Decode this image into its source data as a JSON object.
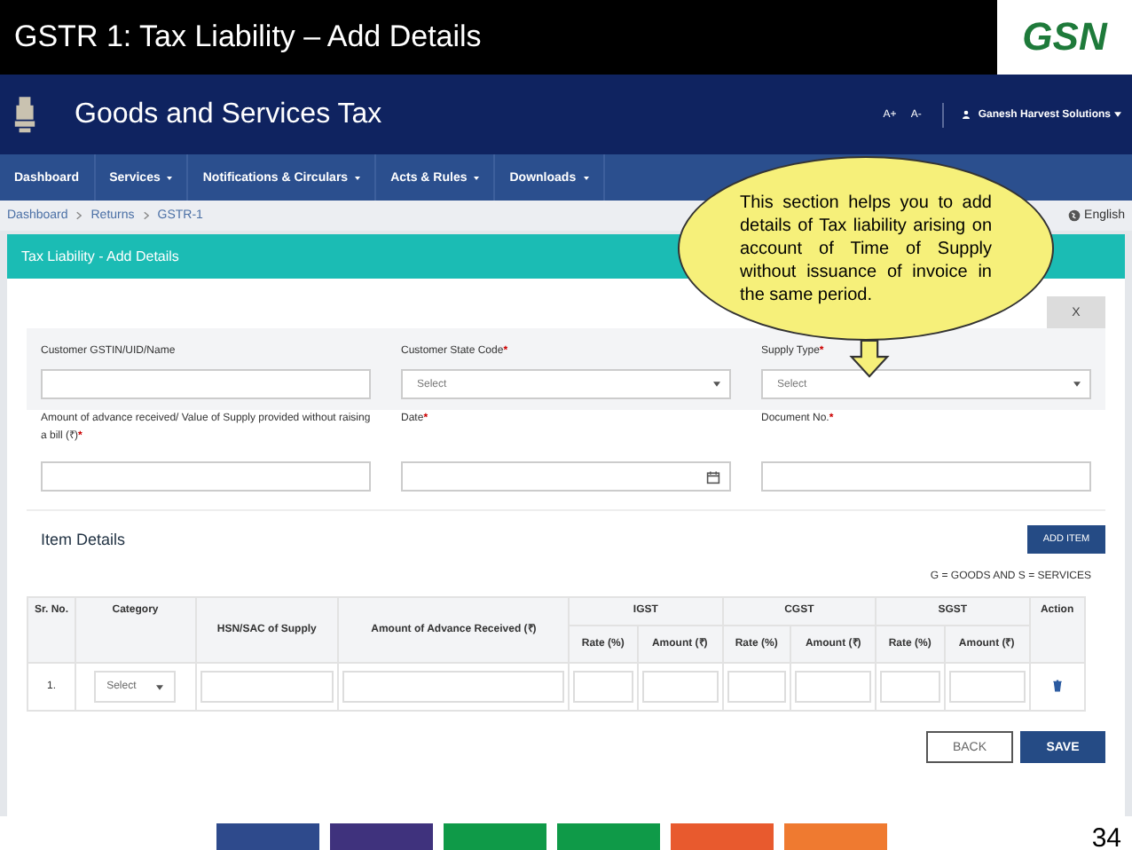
{
  "slide": {
    "title": "GSTR 1: Tax Liability – Add Details",
    "logo_text": "GSN",
    "page_number": "34"
  },
  "header": {
    "site_title": "Goods and Services Tax",
    "font_up": "A+",
    "font_down": "A-",
    "user": "Ganesh Harvest Solutions"
  },
  "nav": [
    {
      "label": "Dashboard",
      "has_menu": false
    },
    {
      "label": "Services",
      "has_menu": true
    },
    {
      "label": "Notifications & Circulars",
      "has_menu": true
    },
    {
      "label": "Acts & Rules",
      "has_menu": true
    },
    {
      "label": "Downloads",
      "has_menu": true
    }
  ],
  "breadcrumb": [
    "Dashboard",
    "Returns",
    "GSTR-1"
  ],
  "language": "English",
  "panel": {
    "title": "Tax Liability - Add Details",
    "close": "X"
  },
  "fields": [
    {
      "label": "Customer GSTIN/UID/Name",
      "kind": "text"
    },
    {
      "label": "Customer State Code",
      "required_mark": "*",
      "kind": "select",
      "placeholder": "Select"
    },
    {
      "label": "Supply Type",
      "required_mark": "*",
      "kind": "select",
      "placeholder": "Select"
    },
    {
      "label": "Amount of advance received/ Value of Supply provided without raising a bill (₹)",
      "required_mark": "*",
      "kind": "text"
    },
    {
      "label": "Date",
      "required_mark": "*",
      "kind": "date"
    },
    {
      "label": "Document No.",
      "required_mark": "*",
      "kind": "text"
    }
  ],
  "items": {
    "title": "Item Details",
    "add_button": "ADD ITEM",
    "legend": "G = GOODS AND S = SERVICES"
  },
  "table": {
    "columns": [
      "Sr. No.",
      "Category",
      "HSN/SAC of Supply",
      "Amount of Advance Received (₹)"
    ],
    "groups": [
      "IGST",
      "CGST",
      "SGST"
    ],
    "subcolumns": [
      "Rate (%)",
      "Amount (₹)",
      "Rate (%)",
      "Amount (₹)",
      "Rate (%)",
      "Amount (₹)"
    ],
    "action": "Action",
    "rows": [
      {
        "sr": "1.",
        "category": "Select"
      }
    ]
  },
  "buttons": [
    {
      "label": "BACK",
      "kind": "secondary"
    },
    {
      "label": "SAVE",
      "kind": "primary"
    }
  ],
  "callout": "This section helps you to add details of Tax liability arising on account of Time of Supply without issuance of invoice in the same period.",
  "footer_stripes": [
    {
      "color": "#2e4a8c"
    },
    {
      "color": "#3f327d"
    },
    {
      "color": "#0f9a48"
    },
    {
      "color": "#0f9a48"
    },
    {
      "color": "#e85a2e"
    },
    {
      "color": "#ef7a30"
    }
  ]
}
